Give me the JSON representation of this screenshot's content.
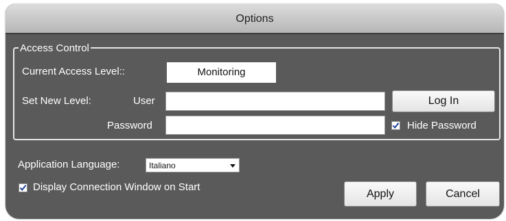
{
  "window": {
    "title": "Options"
  },
  "access_control": {
    "legend": "Access Control",
    "current_level_label": "Current Access Level::",
    "current_level_value": "Monitoring",
    "set_new_level_label": "Set New Level:",
    "user_label": "User",
    "user_value": "",
    "password_label": "Password",
    "password_value": "",
    "login_button": "Log In",
    "hide_password_label": "Hide Password",
    "hide_password_checked": true
  },
  "application_language": {
    "label": "Application Language:",
    "selected": "Italiano"
  },
  "display_connection": {
    "label": "Display Connection Window on Start",
    "checked": true
  },
  "buttons": {
    "apply": "Apply",
    "cancel": "Cancel"
  },
  "icons": {
    "checkbox_mark": "checkmark-icon",
    "dropdown": "chevron-down-icon"
  }
}
